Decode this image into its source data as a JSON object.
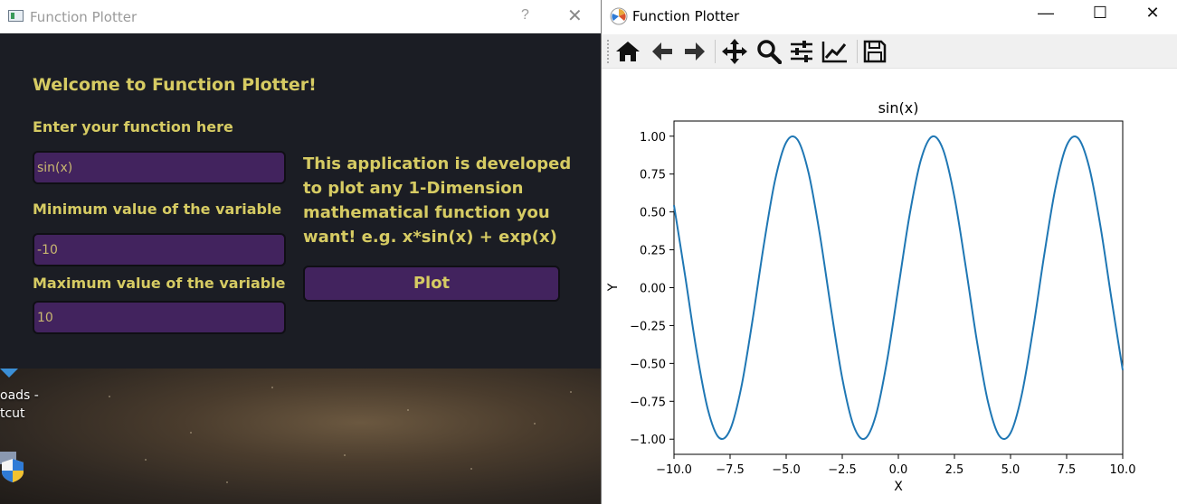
{
  "dialog": {
    "title": "Function Plotter",
    "help_glyph": "?",
    "close_glyph": "✕",
    "welcome": "Welcome to Function Plotter!",
    "function_label": "Enter your function here",
    "function_value": "sin(x)",
    "min_label": "Minimum value of the variable",
    "min_value": "-10",
    "max_label": "Maximum value of the variable",
    "max_value": "10",
    "description": "This application is developed to plot any 1-Dimension mathematical function you want! e.g. x*sin(x) + exp(x)",
    "plot_button": "Plot"
  },
  "desktop": {
    "shortcut_line1": "oads -",
    "shortcut_line2": "tcut"
  },
  "window": {
    "title": "Function Plotter",
    "minimize_glyph": "—",
    "maximize_glyph": "☐",
    "close_glyph": "✕",
    "toolbar": [
      {
        "name": "home-icon",
        "tip": "Home"
      },
      {
        "name": "back-icon",
        "tip": "Back"
      },
      {
        "name": "forward-icon",
        "tip": "Forward"
      },
      {
        "name": "pan-icon",
        "tip": "Pan"
      },
      {
        "name": "zoom-icon",
        "tip": "Zoom"
      },
      {
        "name": "subplots-icon",
        "tip": "Subplots"
      },
      {
        "name": "customize-icon",
        "tip": "Customize"
      },
      {
        "name": "save-icon",
        "tip": "Save"
      }
    ]
  },
  "chart_data": {
    "type": "line",
    "title": "sin(x)",
    "xlabel": "X",
    "ylabel": "Y",
    "xlim": [
      -10,
      10
    ],
    "ylim": [
      -1.1,
      1.1
    ],
    "xticks": [
      -10,
      -7.5,
      -5,
      -2.5,
      0,
      2.5,
      5,
      7.5,
      10
    ],
    "xtick_labels": [
      "−10.0",
      "−7.5",
      "−5.0",
      "−2.5",
      "0.0",
      "2.5",
      "5.0",
      "7.5",
      "10.0"
    ],
    "yticks": [
      -1,
      -0.75,
      -0.5,
      -0.25,
      0,
      0.25,
      0.5,
      0.75,
      1
    ],
    "ytick_labels": [
      "−1.00",
      "−0.75",
      "−0.50",
      "−0.25",
      "0.00",
      "0.25",
      "0.50",
      "0.75",
      "1.00"
    ],
    "grid": false,
    "series": [
      {
        "color": "#1f77b4",
        "x": [
          -10,
          -9.5,
          -9,
          -8.5,
          -8,
          -7.5,
          -7,
          -6.5,
          -6,
          -5.5,
          -5,
          -4.5,
          -4,
          -3.5,
          -3,
          -2.5,
          -2,
          -1.5,
          -1,
          -0.5,
          0,
          0.5,
          1,
          1.5,
          2,
          2.5,
          3,
          3.5,
          4,
          4.5,
          5,
          5.5,
          6,
          6.5,
          7,
          7.5,
          8,
          8.5,
          9,
          9.5,
          10
        ],
        "y": [
          0.544,
          0.075,
          -0.412,
          -0.798,
          -0.989,
          -0.938,
          -0.657,
          -0.215,
          0.279,
          0.706,
          0.959,
          0.978,
          0.757,
          0.351,
          -0.141,
          -0.598,
          -0.909,
          -0.997,
          -0.841,
          -0.479,
          0,
          0.479,
          0.841,
          0.997,
          0.909,
          0.598,
          0.141,
          -0.351,
          -0.757,
          -0.978,
          -0.959,
          -0.706,
          -0.279,
          0.215,
          0.657,
          0.938,
          0.989,
          0.798,
          0.412,
          -0.075,
          -0.544
        ]
      }
    ]
  }
}
